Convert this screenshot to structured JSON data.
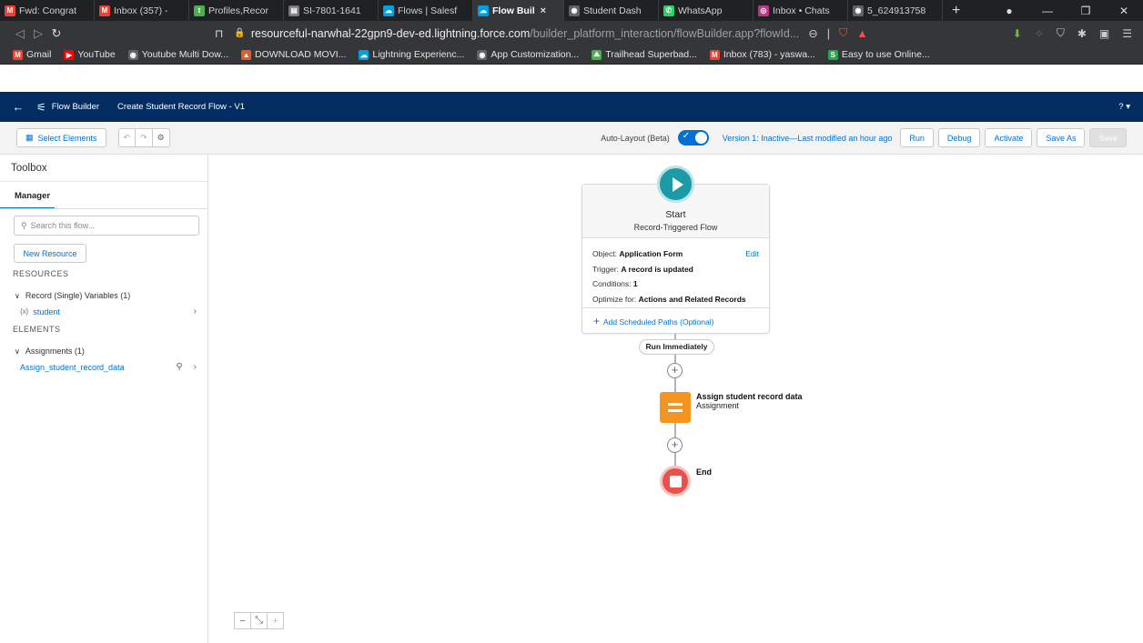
{
  "browser": {
    "tabs": [
      {
        "label": "Fwd: Congrat",
        "icon": "gmail-icon",
        "color": "#ea4335",
        "glyph": "M"
      },
      {
        "label": "Inbox (357) -",
        "icon": "gmail-icon",
        "color": "#ea4335",
        "glyph": "M"
      },
      {
        "label": "Profiles,Recor",
        "icon": "trailhead-icon",
        "color": "#4caf50",
        "glyph": "t"
      },
      {
        "label": "SI-7801-1641",
        "icon": "document-icon",
        "color": "#7a7a7a",
        "glyph": "▤"
      },
      {
        "label": "Flows | Salesf",
        "icon": "salesforce-cloud-icon",
        "color": "#00a1e0",
        "glyph": "☁"
      },
      {
        "label": "Flow Buil",
        "icon": "salesforce-cloud-icon",
        "color": "#00a1e0",
        "glyph": "☁",
        "active": true
      },
      {
        "label": "Student Dash",
        "icon": "globe-icon",
        "color": "#5f6368",
        "glyph": "◉"
      },
      {
        "label": "WhatsApp",
        "icon": "whatsapp-icon",
        "color": "#25d366",
        "glyph": "✆"
      },
      {
        "label": "Inbox • Chats",
        "icon": "instagram-icon",
        "color": "#c13584",
        "glyph": "◎"
      },
      {
        "label": "5_624913758",
        "icon": "globe-icon",
        "color": "#5f6368",
        "glyph": "◉"
      }
    ],
    "tab_close": "×",
    "new_tab": "+",
    "address": {
      "host": "resourceful-narwhal-22gpn9-dev-ed.lightning.force.com",
      "path": "/builder_platform_interaction/flowBuilder.app?flowId..."
    },
    "bookmarks": [
      {
        "label": "Gmail",
        "icon": "gmail-icon",
        "color": "#ea4335",
        "glyph": "M"
      },
      {
        "label": "YouTube",
        "icon": "youtube-icon",
        "color": "#ff0000",
        "glyph": "▶"
      },
      {
        "label": "Youtube Multi Dow...",
        "icon": "globe-icon",
        "color": "#5f6368",
        "glyph": "◉"
      },
      {
        "label": "DOWNLOAD MOVI...",
        "icon": "movie-icon",
        "color": "#e25c2a",
        "glyph": "▲"
      },
      {
        "label": "Lightning Experienc...",
        "icon": "salesforce-cloud-icon",
        "color": "#00a1e0",
        "glyph": "☁"
      },
      {
        "label": "App Customization...",
        "icon": "globe-icon",
        "color": "#5f6368",
        "glyph": "◉"
      },
      {
        "label": "Trailhead Superbad...",
        "icon": "trailhead-icon",
        "color": "#4caf50",
        "glyph": "⛰"
      },
      {
        "label": "Inbox (783) - yaswa...",
        "icon": "gmail-icon",
        "color": "#ea4335",
        "glyph": "M"
      },
      {
        "label": "Easy to use Online...",
        "icon": "s-icon",
        "color": "#2ea44f",
        "glyph": "S"
      }
    ]
  },
  "sf_header": {
    "back": "←",
    "app": "Flow Builder",
    "flow_title": "Create Student Record Flow - V1",
    "help": "? ▾"
  },
  "toolbar": {
    "select_elements": "Select Elements",
    "auto_layout_label": "Auto-Layout (Beta)",
    "version_text": "Version 1: Inactive—Last modified an hour ago",
    "run": "Run",
    "debug": "Debug",
    "activate": "Activate",
    "save_as": "Save As",
    "save": "Save"
  },
  "left_panel": {
    "title": "Toolbox",
    "tab": "Manager",
    "search_placeholder": "Search this flow...",
    "new_resource": "New Resource",
    "resources_label": "RESOURCES",
    "record_group": "Record (Single) Variables (1)",
    "record_var": "student",
    "elements_label": "ELEMENTS",
    "assignments_group": "Assignments (1)",
    "assignment_item": "Assign_student_record_data"
  },
  "canvas": {
    "start": {
      "title": "Start",
      "subtitle": "Record-Triggered Flow",
      "object_label": "Object:",
      "object_value": "Application Form",
      "trigger_label": "Trigger:",
      "trigger_value": "A record is updated",
      "conditions_label": "Conditions:",
      "conditions_value": "1",
      "optimize_label": "Optimize for:",
      "optimize_value": "Actions and Related Records",
      "edit": "Edit",
      "add_scheduled": "Add Scheduled Paths (Optional)"
    },
    "run_immediately": "Run Immediately",
    "assignment": {
      "title": "Assign student record data",
      "type": "Assignment"
    },
    "end": "End"
  },
  "colors": {
    "header_navy": "#032d60",
    "brand_blue": "#0070d2",
    "start_teal": "#1c9aa6",
    "assignment_orange": "#f49522",
    "end_red": "#e8524b"
  }
}
